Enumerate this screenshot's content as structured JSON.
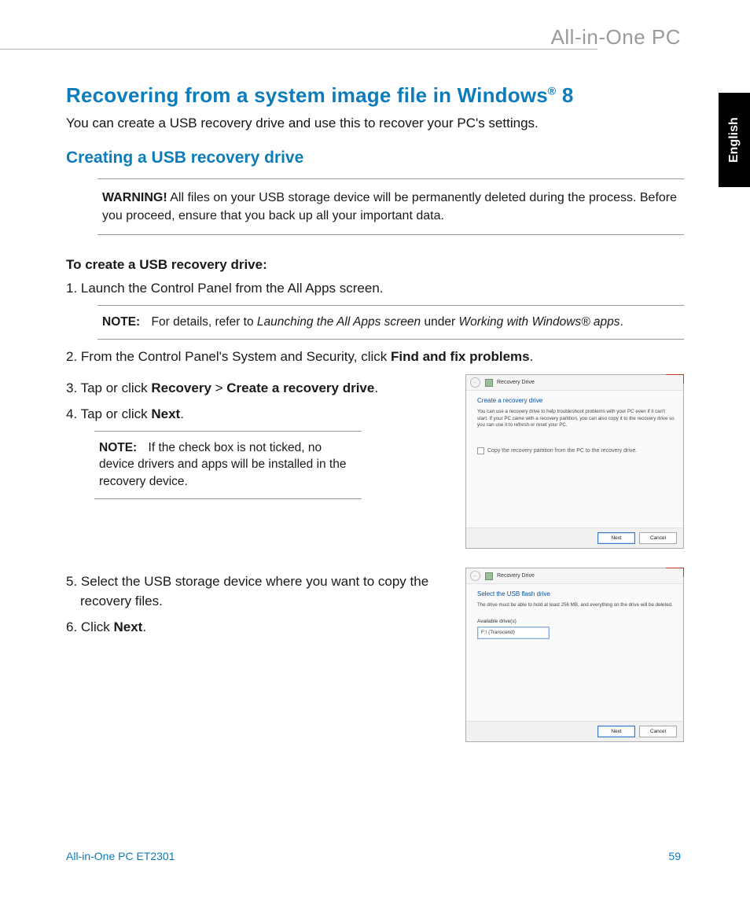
{
  "brand_text": "All-in-One PC",
  "lang_tab": "English",
  "title_main": "Recovering from a system image file in Windows",
  "title_reg": "®",
  "title_ver": " 8",
  "intro": "You can create a USB recovery drive and use this to recover your PC's settings.",
  "sub_heading": "Creating a USB recovery drive",
  "warning": {
    "lead": "WARNING!",
    "body": "  All files on your USB storage device will be permanently deleted during the process. Before you proceed, ensure that you back up all your important data."
  },
  "instr_head": "To create a USB recovery drive:",
  "step1": "1. Launch the Control Panel from the All Apps screen.",
  "note1": {
    "lead": "NOTE:",
    "pre": "For details, refer to ",
    "em1": "Launching the All Apps screen",
    "mid": " under ",
    "em2": "Working with Windows® apps",
    "post": "."
  },
  "step2_pre": "2. From the Control Panel's System and Security, click ",
  "step2_bold": "Find and fix problems",
  "step2_post": ".",
  "step3_pre": "3. Tap or click ",
  "step3_b1": "Recovery",
  "step3_mid": " > ",
  "step3_b2": "Create a recovery drive",
  "step3_post": ".",
  "step4_pre": "4. Tap or click ",
  "step4_bold": "Next",
  "step4_post": ".",
  "note2": {
    "lead": "NOTE:",
    "body": "If the check box is not ticked, no device drivers and apps will be installed in the recovery device."
  },
  "step5": "5. Select the USB storage device where you want to copy the recovery files.",
  "step6_pre": "6. Click ",
  "step6_bold": "Next",
  "step6_post": ".",
  "dialog1": {
    "title": "Recovery Drive",
    "heading": "Create a recovery drive",
    "text": "You can use a recovery drive to help troubleshoot problems with your PC even if it can't start. If your PC came with a recovery partition, you can also copy it to the recovery drive so you can use it to refresh or reset your PC.",
    "checkbox": "Copy the recovery partition from the PC to the recovery drive.",
    "btn_next": "Next",
    "btn_cancel": "Cancel"
  },
  "dialog2": {
    "title": "Recovery Drive",
    "heading": "Select the USB flash drive",
    "text": "The drive must be able to hold at least 256 MB, and everything on the drive will be deleted.",
    "list_label": "Available drive(s)",
    "list_item": "F:\\ (Transcend)",
    "btn_next": "Next",
    "btn_cancel": "Cancel"
  },
  "footer_model": "All-in-One PC ET2301",
  "footer_page": "59"
}
